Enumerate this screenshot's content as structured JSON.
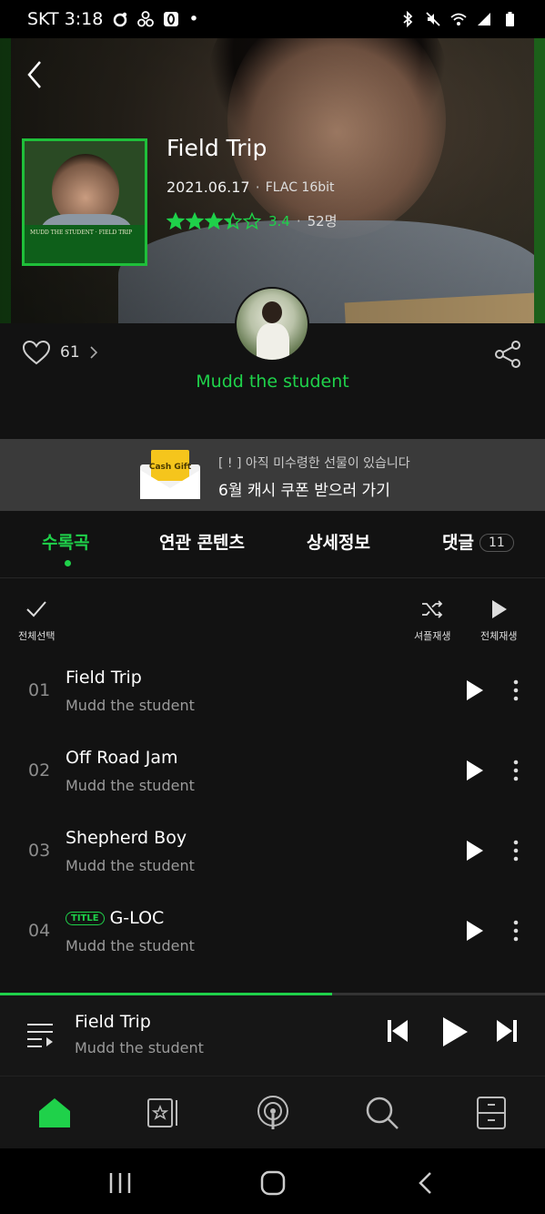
{
  "status_bar": {
    "carrier_time": "SKT 3:18",
    "dot": "•"
  },
  "album": {
    "title": "Field Trip",
    "release_date": "2021.06.17",
    "format": "FLAC 16bit",
    "rating_stars": 3.4,
    "rating": "3.4",
    "rating_count": "52명",
    "likes": "61",
    "artist": "Mudd the student",
    "art_caption": "MUDD THE STUDENT · FIELD TRIP"
  },
  "banner": {
    "gift_label": "Cash Gift",
    "subtext": "[ ! ] 아직 미수령한 선물이 있습니다",
    "main": "6월 캐시 쿠폰 받으러 가기"
  },
  "tabs": [
    {
      "label": "수록곡",
      "active": true
    },
    {
      "label": "연관 콘텐츠"
    },
    {
      "label": "상세정보"
    },
    {
      "label": "댓글",
      "badge": "11"
    }
  ],
  "toolbar": {
    "select_all": "전체선택",
    "shuffle": "셔플재생",
    "play_all": "전체재생"
  },
  "tracks": [
    {
      "num": "01",
      "title": "Field Trip",
      "artist": "Mudd the student"
    },
    {
      "num": "02",
      "title": "Off Road Jam",
      "artist": "Mudd the student"
    },
    {
      "num": "03",
      "title": "Shepherd Boy",
      "artist": "Mudd the student"
    },
    {
      "num": "04",
      "title": "G-LOC",
      "artist": "Mudd the student",
      "tag": "TITLE"
    }
  ],
  "now_playing": {
    "title": "Field Trip",
    "artist": "Mudd the student",
    "progress": 0.61
  },
  "bottom_nav": [
    "home-icon",
    "library-icon",
    "podcast-icon",
    "search-icon",
    "storage-icon"
  ],
  "colors": {
    "accent": "#1fd14a",
    "background": "#121212",
    "banner": "#3a3a3a"
  }
}
